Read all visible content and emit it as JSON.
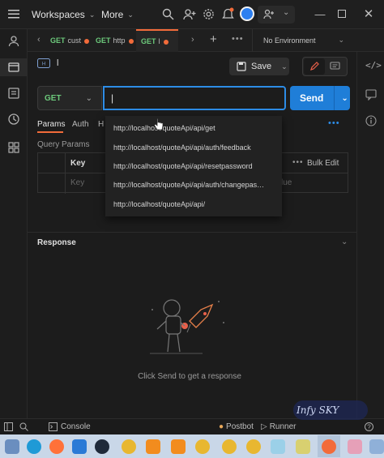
{
  "topbar": {
    "workspaces_label": "Workspaces",
    "more_label": "More"
  },
  "tabs": [
    {
      "method": "GET",
      "label": "cust"
    },
    {
      "method": "GET",
      "label": "http"
    },
    {
      "method": "GET",
      "label": "l"
    }
  ],
  "environment": "No Environment",
  "request": {
    "name": "l",
    "save_label": "Save",
    "method": "GET",
    "url_value": "|",
    "send_label": "Send"
  },
  "subtabs": [
    "Params",
    "Auth",
    "H"
  ],
  "params": {
    "section_title": "Query Params",
    "key_header": "Key",
    "key_placeholder": "Key",
    "value_placeholder": "lue",
    "bulk_edit_label": "Bulk Edit"
  },
  "suggestions": [
    "http://localhost/quoteApi/api/get",
    "http://localhost/quoteApi/api/auth/feedback",
    "http://localhost/quoteApi/api/resetpassword",
    "http://localhost/quoteApi/api/auth/changepas…",
    "http://localhost/quoteApi/api/"
  ],
  "response": {
    "title": "Response",
    "empty_message": "Click Send to get a response"
  },
  "statusbar": {
    "console_label": "Console",
    "postbot_label": "Postbot",
    "runner_label": "Runner"
  },
  "watermark": "Infy SKY",
  "colors": {
    "accent_orange": "#f26b3a",
    "send_blue": "#1f7ed8",
    "get_green": "#6cc97b"
  }
}
